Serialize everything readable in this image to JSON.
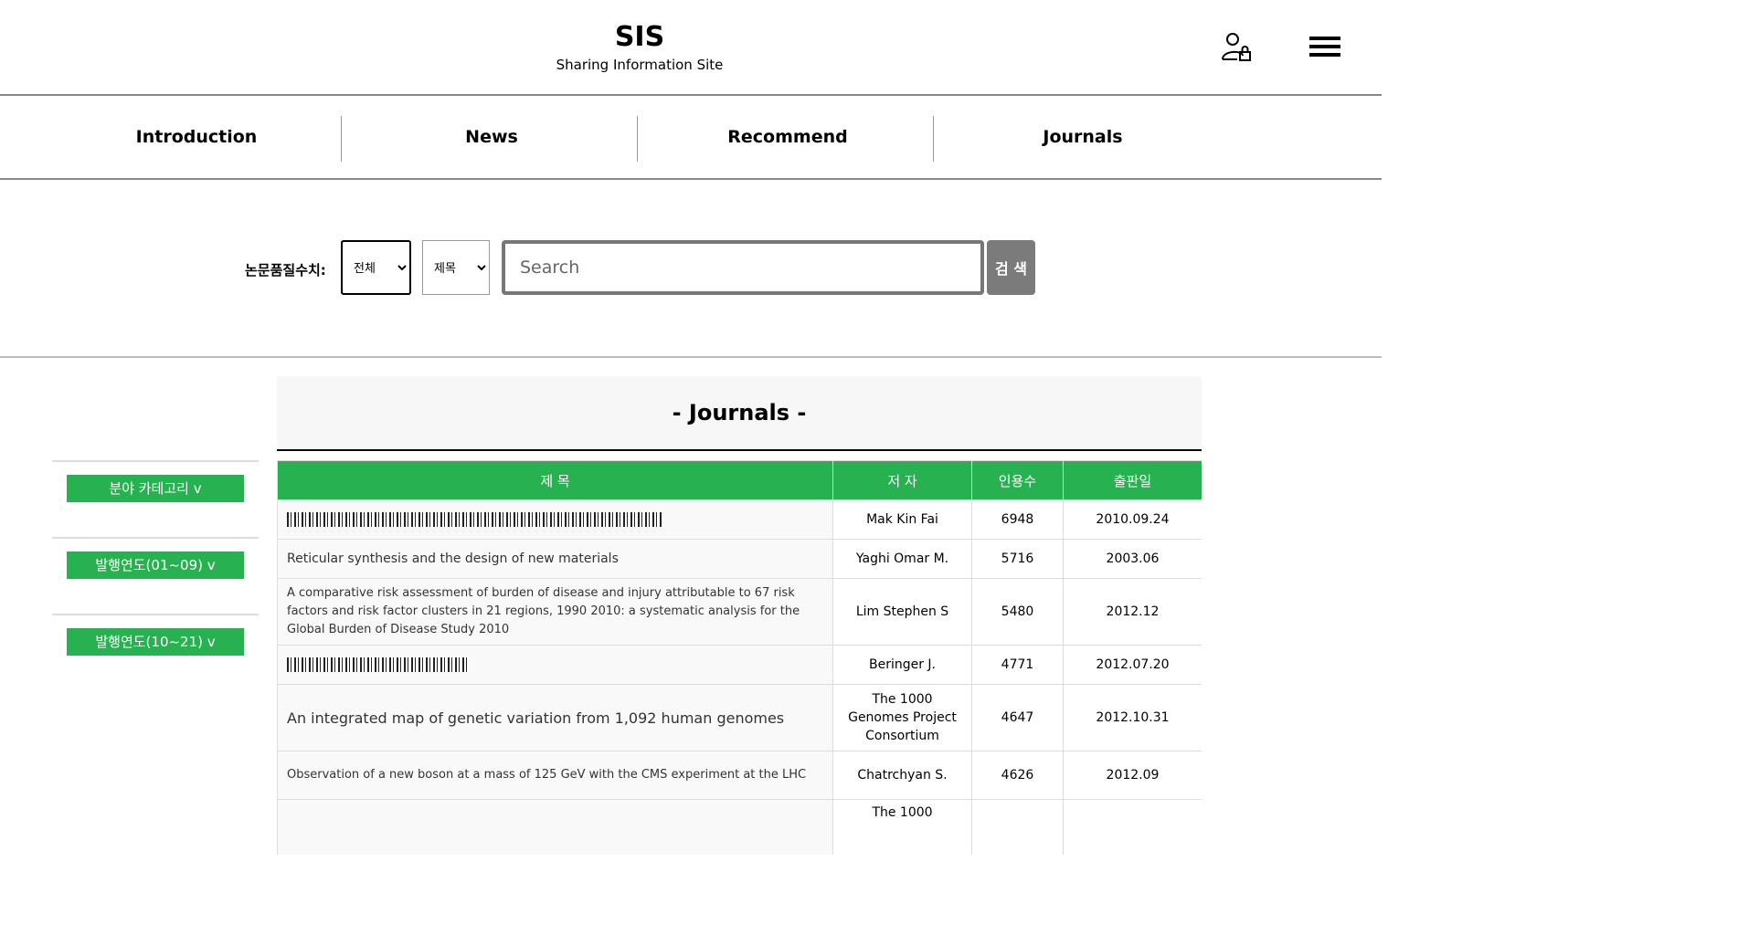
{
  "header": {
    "title": "SIS",
    "subtitle": "Sharing Information Site",
    "user_icon": "user-lock-icon",
    "menu_icon": "hamburger-menu-icon"
  },
  "nav": {
    "items": [
      {
        "label": "Introduction"
      },
      {
        "label": "News"
      },
      {
        "label": "Recommend"
      },
      {
        "label": "Journals"
      }
    ]
  },
  "search": {
    "label": "논문품질수치:",
    "quality_select": "전체",
    "field_select": "제목",
    "placeholder": "Search",
    "button_label": "검 색"
  },
  "sidebar": {
    "items": [
      {
        "label": "분야 카테고리 v"
      },
      {
        "label": "발행연도(01~09) v"
      },
      {
        "label": "발행연도(10~21) v"
      }
    ]
  },
  "journals": {
    "heading": "- Journals -",
    "columns": [
      "제 목",
      "저 자",
      "인용수",
      "출판일"
    ],
    "rows": [
      {
        "title": "",
        "author": "Mak Kin Fai",
        "citations": "6948",
        "date": "2010.09.24"
      },
      {
        "title": "Reticular synthesis and the design of new materials",
        "author": "Yaghi Omar M.",
        "citations": "5716",
        "date": "2003.06"
      },
      {
        "title": "A comparative risk assessment of burden of disease and injury attributable to 67 risk factors and risk factor clusters in 21 regions, 1990 2010: a systematic analysis for the Global Burden of Disease Study 2010",
        "author": "Lim Stephen S",
        "citations": "5480",
        "date": "2012.12"
      },
      {
        "title": "",
        "author": "Beringer J.",
        "citations": "4771",
        "date": "2012.07.20"
      },
      {
        "title": "An integrated map of genetic variation from 1,092 human genomes",
        "author": "The 1000 Genomes Project Consortium",
        "citations": "4647",
        "date": "2012.10.31"
      },
      {
        "title": "Observation of a new boson at a mass of 125 GeV with the CMS experiment at the LHC",
        "author": "Chatrchyan S.",
        "citations": "4626",
        "date": "2012.09"
      },
      {
        "title": "",
        "author": "The 1000",
        "citations": "",
        "date": ""
      }
    ]
  }
}
